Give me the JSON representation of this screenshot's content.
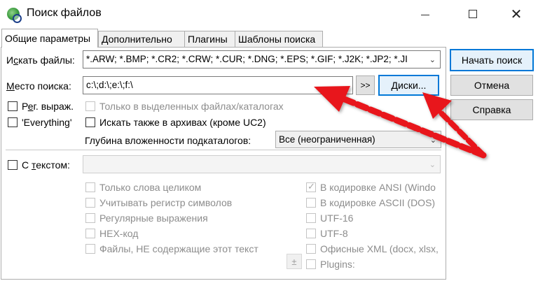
{
  "window": {
    "title": "Поиск файлов",
    "controls": {
      "minimize": "—",
      "maximize": "☐",
      "close": "✕"
    }
  },
  "tabs": [
    {
      "label": "Общие параметры"
    },
    {
      "label": "Дополнительно"
    },
    {
      "label": "Плагины"
    },
    {
      "label": "Шаблоны поиска"
    }
  ],
  "search_files": {
    "label_pre": "И",
    "label_u": "с",
    "label_post": "кать файлы:",
    "value": "*.ARW; *.BMP; *.CR2; *.CRW; *.CUR; *.DNG; *.EPS; *.GIF; *.J2K; *.JP2; *.JI"
  },
  "search_location": {
    "label_u": "М",
    "label_post": "есто поиска:",
    "value": "c:\\;d:\\;e:\\;f:\\",
    "expand_button": ">>",
    "drives_button": "Диски..."
  },
  "options": {
    "regex_pre": "Р",
    "regex_u": "е",
    "regex_post": "г. выраж.",
    "everything": "'Everything'",
    "only_selected": "Только в выделенных файлах/каталогах",
    "archives": "Искать также в архивах (кроме UC2)",
    "depth_label": "Глубина вложенности подкаталогов:",
    "depth_value": "Все (неограниченная)"
  },
  "text_search": {
    "label_pre": "С ",
    "label_u": "т",
    "label_post": "екстом:",
    "value": ""
  },
  "text_options_left": [
    "Только слова целиком",
    "Учитывать регистр символов",
    "Регулярные выражения",
    "HEX-код",
    "Файлы, НЕ содержащие этот текст"
  ],
  "text_options_right": [
    {
      "label": "В кодировке ANSI (Windo",
      "checked": true
    },
    {
      "label": "В кодировке ASCII (DOS)",
      "checked": false
    },
    {
      "label": "UTF-16",
      "checked": false
    },
    {
      "label": "UTF-8",
      "checked": false
    },
    {
      "label": "Офисные XML (docx, xlsx,",
      "checked": false
    },
    {
      "label": "Plugins:",
      "checked": false
    }
  ],
  "plus_button": "±",
  "buttons": {
    "start": "Начать поиск",
    "cancel": "Отмена",
    "help": "Справка"
  },
  "colors": {
    "annotation_arrow": "#e8191c",
    "default_button_border": "#0078d7"
  }
}
